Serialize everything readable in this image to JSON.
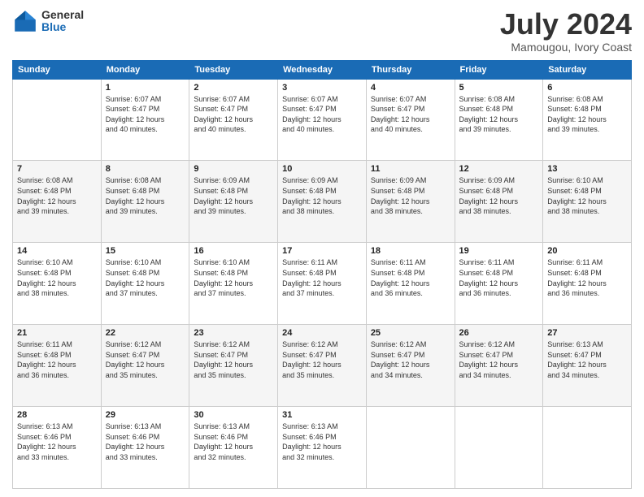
{
  "logo": {
    "general": "General",
    "blue": "Blue"
  },
  "title": "July 2024",
  "subtitle": "Mamougou, Ivory Coast",
  "days_header": [
    "Sunday",
    "Monday",
    "Tuesday",
    "Wednesday",
    "Thursday",
    "Friday",
    "Saturday"
  ],
  "weeks": [
    [
      {
        "day": "",
        "info": ""
      },
      {
        "day": "1",
        "info": "Sunrise: 6:07 AM\nSunset: 6:47 PM\nDaylight: 12 hours\nand 40 minutes."
      },
      {
        "day": "2",
        "info": "Sunrise: 6:07 AM\nSunset: 6:47 PM\nDaylight: 12 hours\nand 40 minutes."
      },
      {
        "day": "3",
        "info": "Sunrise: 6:07 AM\nSunset: 6:47 PM\nDaylight: 12 hours\nand 40 minutes."
      },
      {
        "day": "4",
        "info": "Sunrise: 6:07 AM\nSunset: 6:47 PM\nDaylight: 12 hours\nand 40 minutes."
      },
      {
        "day": "5",
        "info": "Sunrise: 6:08 AM\nSunset: 6:48 PM\nDaylight: 12 hours\nand 39 minutes."
      },
      {
        "day": "6",
        "info": "Sunrise: 6:08 AM\nSunset: 6:48 PM\nDaylight: 12 hours\nand 39 minutes."
      }
    ],
    [
      {
        "day": "7",
        "info": "Sunrise: 6:08 AM\nSunset: 6:48 PM\nDaylight: 12 hours\nand 39 minutes."
      },
      {
        "day": "8",
        "info": "Sunrise: 6:08 AM\nSunset: 6:48 PM\nDaylight: 12 hours\nand 39 minutes."
      },
      {
        "day": "9",
        "info": "Sunrise: 6:09 AM\nSunset: 6:48 PM\nDaylight: 12 hours\nand 39 minutes."
      },
      {
        "day": "10",
        "info": "Sunrise: 6:09 AM\nSunset: 6:48 PM\nDaylight: 12 hours\nand 38 minutes."
      },
      {
        "day": "11",
        "info": "Sunrise: 6:09 AM\nSunset: 6:48 PM\nDaylight: 12 hours\nand 38 minutes."
      },
      {
        "day": "12",
        "info": "Sunrise: 6:09 AM\nSunset: 6:48 PM\nDaylight: 12 hours\nand 38 minutes."
      },
      {
        "day": "13",
        "info": "Sunrise: 6:10 AM\nSunset: 6:48 PM\nDaylight: 12 hours\nand 38 minutes."
      }
    ],
    [
      {
        "day": "14",
        "info": "Sunrise: 6:10 AM\nSunset: 6:48 PM\nDaylight: 12 hours\nand 38 minutes."
      },
      {
        "day": "15",
        "info": "Sunrise: 6:10 AM\nSunset: 6:48 PM\nDaylight: 12 hours\nand 37 minutes."
      },
      {
        "day": "16",
        "info": "Sunrise: 6:10 AM\nSunset: 6:48 PM\nDaylight: 12 hours\nand 37 minutes."
      },
      {
        "day": "17",
        "info": "Sunrise: 6:11 AM\nSunset: 6:48 PM\nDaylight: 12 hours\nand 37 minutes."
      },
      {
        "day": "18",
        "info": "Sunrise: 6:11 AM\nSunset: 6:48 PM\nDaylight: 12 hours\nand 36 minutes."
      },
      {
        "day": "19",
        "info": "Sunrise: 6:11 AM\nSunset: 6:48 PM\nDaylight: 12 hours\nand 36 minutes."
      },
      {
        "day": "20",
        "info": "Sunrise: 6:11 AM\nSunset: 6:48 PM\nDaylight: 12 hours\nand 36 minutes."
      }
    ],
    [
      {
        "day": "21",
        "info": "Sunrise: 6:11 AM\nSunset: 6:48 PM\nDaylight: 12 hours\nand 36 minutes."
      },
      {
        "day": "22",
        "info": "Sunrise: 6:12 AM\nSunset: 6:47 PM\nDaylight: 12 hours\nand 35 minutes."
      },
      {
        "day": "23",
        "info": "Sunrise: 6:12 AM\nSunset: 6:47 PM\nDaylight: 12 hours\nand 35 minutes."
      },
      {
        "day": "24",
        "info": "Sunrise: 6:12 AM\nSunset: 6:47 PM\nDaylight: 12 hours\nand 35 minutes."
      },
      {
        "day": "25",
        "info": "Sunrise: 6:12 AM\nSunset: 6:47 PM\nDaylight: 12 hours\nand 34 minutes."
      },
      {
        "day": "26",
        "info": "Sunrise: 6:12 AM\nSunset: 6:47 PM\nDaylight: 12 hours\nand 34 minutes."
      },
      {
        "day": "27",
        "info": "Sunrise: 6:13 AM\nSunset: 6:47 PM\nDaylight: 12 hours\nand 34 minutes."
      }
    ],
    [
      {
        "day": "28",
        "info": "Sunrise: 6:13 AM\nSunset: 6:46 PM\nDaylight: 12 hours\nand 33 minutes."
      },
      {
        "day": "29",
        "info": "Sunrise: 6:13 AM\nSunset: 6:46 PM\nDaylight: 12 hours\nand 33 minutes."
      },
      {
        "day": "30",
        "info": "Sunrise: 6:13 AM\nSunset: 6:46 PM\nDaylight: 12 hours\nand 32 minutes."
      },
      {
        "day": "31",
        "info": "Sunrise: 6:13 AM\nSunset: 6:46 PM\nDaylight: 12 hours\nand 32 minutes."
      },
      {
        "day": "",
        "info": ""
      },
      {
        "day": "",
        "info": ""
      },
      {
        "day": "",
        "info": ""
      }
    ]
  ]
}
